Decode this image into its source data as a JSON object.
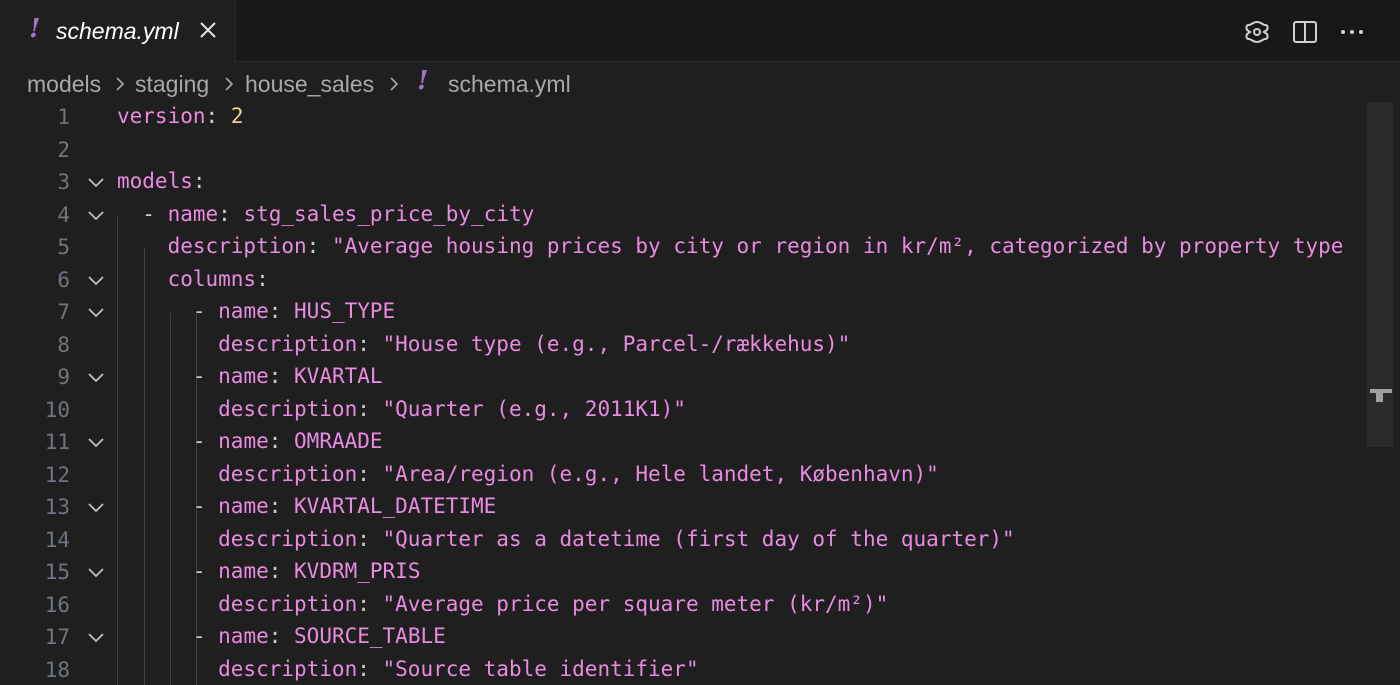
{
  "tab": {
    "title": "schema.yml",
    "icon": "yaml-file-icon"
  },
  "breadcrumb": {
    "items": [
      "models",
      "staging",
      "house_sales",
      "schema.yml"
    ]
  },
  "editor": {
    "lines": [
      {
        "num": "1",
        "text": "version: 2"
      },
      {
        "num": "2",
        "text": ""
      },
      {
        "num": "3",
        "text": "models:"
      },
      {
        "num": "4",
        "text": "  - name: stg_sales_price_by_city"
      },
      {
        "num": "5",
        "text": "    description: \"Average housing prices by city or region in kr/m², categorized by property type"
      },
      {
        "num": "6",
        "text": "    columns:"
      },
      {
        "num": "7",
        "text": "      - name: HUS_TYPE"
      },
      {
        "num": "8",
        "text": "        description: \"House type (e.g., Parcel-/rækkehus)\""
      },
      {
        "num": "9",
        "text": "      - name: KVARTAL"
      },
      {
        "num": "10",
        "text": "        description: \"Quarter (e.g., 2011K1)\""
      },
      {
        "num": "11",
        "text": "      - name: OMRAADE"
      },
      {
        "num": "12",
        "text": "        description: \"Area/region (e.g., Hele landet, København)\""
      },
      {
        "num": "13",
        "text": "      - name: KVARTAL_DATETIME"
      },
      {
        "num": "14",
        "text": "        description: \"Quarter as a datetime (first day of the quarter)\""
      },
      {
        "num": "15",
        "text": "      - name: KVDRM_PRIS"
      },
      {
        "num": "16",
        "text": "        description: \"Average price per square meter (kr/m²)\""
      },
      {
        "num": "17",
        "text": "      - name: SOURCE_TABLE"
      },
      {
        "num": "18",
        "text": "        description: \"Source table identifier\""
      }
    ]
  },
  "colors": {
    "key": "#e98be1",
    "number": "#ecd196",
    "punctuation": "#cccccc",
    "yaml_icon": "#a074c4"
  }
}
